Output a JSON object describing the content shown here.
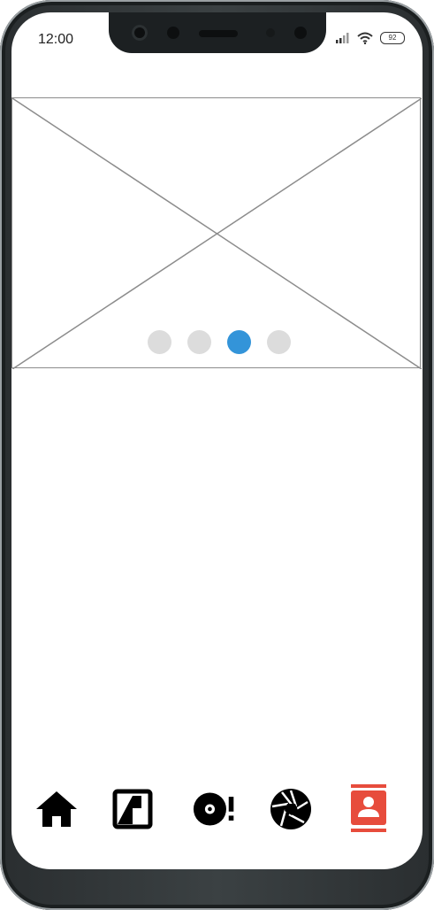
{
  "status_bar": {
    "time": "12:00",
    "battery": "92"
  },
  "carousel": {
    "dot_count": 4,
    "active_index": 2,
    "active_color": "#3394d9",
    "inactive_color": "#dcdcdc"
  },
  "tab_bar": {
    "active_color": "#e74c3c",
    "tabs": [
      {
        "icon": "home-icon",
        "active": false
      },
      {
        "icon": "image-frame-icon",
        "active": false
      },
      {
        "icon": "disc-alert-icon",
        "active": false
      },
      {
        "icon": "aperture-icon",
        "active": false
      },
      {
        "icon": "contact-card-icon",
        "active": true
      }
    ]
  }
}
